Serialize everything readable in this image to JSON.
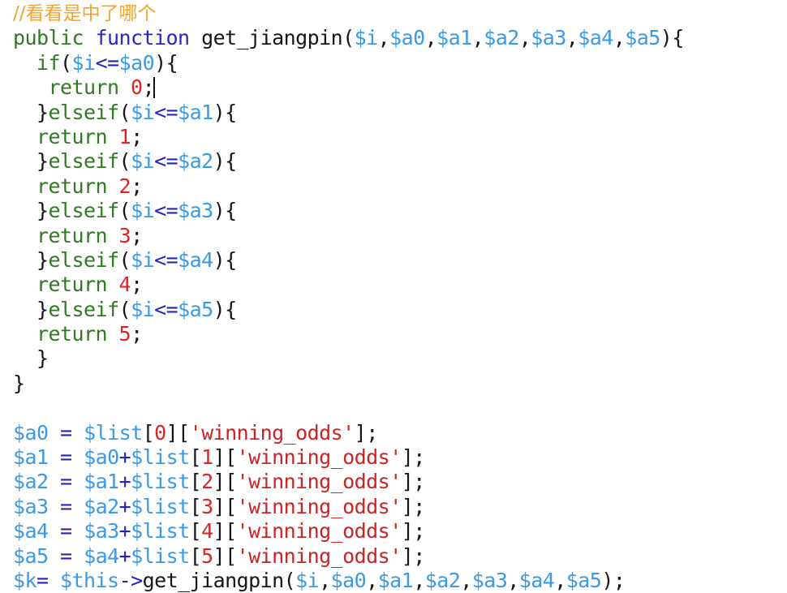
{
  "editor": {
    "language": "PHP",
    "background_color": "#ffffff",
    "caret_line_index": 3,
    "palette": {
      "comment": "#f5a42a",
      "keyword": "#2f7a22",
      "function_keyword": "#2626cc",
      "function_name": "#16161a",
      "variable": "#3a9ae8",
      "operator": "#2424bb",
      "number": "#e02222",
      "string": "#cc2424",
      "punctuation": "#16161a"
    }
  },
  "code_lines": [
    {
      "indent": "",
      "tokens": [
        {
          "t": "//看看是中了哪个",
          "c": "comment"
        }
      ]
    },
    {
      "indent": "",
      "tokens": [
        {
          "t": "public",
          "c": "keyword"
        },
        {
          "t": " ",
          "c": "plain"
        },
        {
          "t": "function",
          "c": "function"
        },
        {
          "t": " ",
          "c": "plain"
        },
        {
          "t": "get_jiangpin",
          "c": "fname"
        },
        {
          "t": "(",
          "c": "punct"
        },
        {
          "t": "$i",
          "c": "var"
        },
        {
          "t": ",",
          "c": "punct"
        },
        {
          "t": "$a0",
          "c": "var"
        },
        {
          "t": ",",
          "c": "punct"
        },
        {
          "t": "$a1",
          "c": "var"
        },
        {
          "t": ",",
          "c": "punct"
        },
        {
          "t": "$a2",
          "c": "var"
        },
        {
          "t": ",",
          "c": "punct"
        },
        {
          "t": "$a3",
          "c": "var"
        },
        {
          "t": ",",
          "c": "punct"
        },
        {
          "t": "$a4",
          "c": "var"
        },
        {
          "t": ",",
          "c": "punct"
        },
        {
          "t": "$a5",
          "c": "var"
        },
        {
          "t": ")",
          "c": "punct"
        },
        {
          "t": "{",
          "c": "punct"
        }
      ]
    },
    {
      "indent": "  ",
      "tokens": [
        {
          "t": "if",
          "c": "keyword"
        },
        {
          "t": "(",
          "c": "punct"
        },
        {
          "t": "$i",
          "c": "var"
        },
        {
          "t": "<=",
          "c": "op"
        },
        {
          "t": "$a0",
          "c": "var"
        },
        {
          "t": ")",
          "c": "punct"
        },
        {
          "t": "{",
          "c": "punct"
        }
      ]
    },
    {
      "indent": "   ",
      "tokens": [
        {
          "t": "return",
          "c": "keyword"
        },
        {
          "t": " ",
          "c": "plain"
        },
        {
          "t": "0",
          "c": "num"
        },
        {
          "t": ";",
          "c": "punct"
        }
      ]
    },
    {
      "indent": "  ",
      "tokens": [
        {
          "t": "}",
          "c": "punct"
        },
        {
          "t": "elseif",
          "c": "keyword"
        },
        {
          "t": "(",
          "c": "punct"
        },
        {
          "t": "$i",
          "c": "var"
        },
        {
          "t": "<=",
          "c": "op"
        },
        {
          "t": "$a1",
          "c": "var"
        },
        {
          "t": ")",
          "c": "punct"
        },
        {
          "t": "{",
          "c": "punct"
        }
      ]
    },
    {
      "indent": "  ",
      "tokens": [
        {
          "t": "return",
          "c": "keyword"
        },
        {
          "t": " ",
          "c": "plain"
        },
        {
          "t": "1",
          "c": "num"
        },
        {
          "t": ";",
          "c": "punct"
        }
      ]
    },
    {
      "indent": "  ",
      "tokens": [
        {
          "t": "}",
          "c": "punct"
        },
        {
          "t": "elseif",
          "c": "keyword"
        },
        {
          "t": "(",
          "c": "punct"
        },
        {
          "t": "$i",
          "c": "var"
        },
        {
          "t": "<=",
          "c": "op"
        },
        {
          "t": "$a2",
          "c": "var"
        },
        {
          "t": ")",
          "c": "punct"
        },
        {
          "t": "{",
          "c": "punct"
        }
      ]
    },
    {
      "indent": "  ",
      "tokens": [
        {
          "t": "return",
          "c": "keyword"
        },
        {
          "t": " ",
          "c": "plain"
        },
        {
          "t": "2",
          "c": "num"
        },
        {
          "t": ";",
          "c": "punct"
        }
      ]
    },
    {
      "indent": "  ",
      "tokens": [
        {
          "t": "}",
          "c": "punct"
        },
        {
          "t": "elseif",
          "c": "keyword"
        },
        {
          "t": "(",
          "c": "punct"
        },
        {
          "t": "$i",
          "c": "var"
        },
        {
          "t": "<=",
          "c": "op"
        },
        {
          "t": "$a3",
          "c": "var"
        },
        {
          "t": ")",
          "c": "punct"
        },
        {
          "t": "{",
          "c": "punct"
        }
      ]
    },
    {
      "indent": "  ",
      "tokens": [
        {
          "t": "return",
          "c": "keyword"
        },
        {
          "t": " ",
          "c": "plain"
        },
        {
          "t": "3",
          "c": "num"
        },
        {
          "t": ";",
          "c": "punct"
        }
      ]
    },
    {
      "indent": "  ",
      "tokens": [
        {
          "t": "}",
          "c": "punct"
        },
        {
          "t": "elseif",
          "c": "keyword"
        },
        {
          "t": "(",
          "c": "punct"
        },
        {
          "t": "$i",
          "c": "var"
        },
        {
          "t": "<=",
          "c": "op"
        },
        {
          "t": "$a4",
          "c": "var"
        },
        {
          "t": ")",
          "c": "punct"
        },
        {
          "t": "{",
          "c": "punct"
        }
      ]
    },
    {
      "indent": "  ",
      "tokens": [
        {
          "t": "return",
          "c": "keyword"
        },
        {
          "t": " ",
          "c": "plain"
        },
        {
          "t": "4",
          "c": "num"
        },
        {
          "t": ";",
          "c": "punct"
        }
      ]
    },
    {
      "indent": "  ",
      "tokens": [
        {
          "t": "}",
          "c": "punct"
        },
        {
          "t": "elseif",
          "c": "keyword"
        },
        {
          "t": "(",
          "c": "punct"
        },
        {
          "t": "$i",
          "c": "var"
        },
        {
          "t": "<=",
          "c": "op"
        },
        {
          "t": "$a5",
          "c": "var"
        },
        {
          "t": ")",
          "c": "punct"
        },
        {
          "t": "{",
          "c": "punct"
        }
      ]
    },
    {
      "indent": "  ",
      "tokens": [
        {
          "t": "return",
          "c": "keyword"
        },
        {
          "t": " ",
          "c": "plain"
        },
        {
          "t": "5",
          "c": "num"
        },
        {
          "t": ";",
          "c": "punct"
        }
      ]
    },
    {
      "indent": "  ",
      "tokens": [
        {
          "t": "}",
          "c": "punct"
        }
      ]
    },
    {
      "indent": "",
      "tokens": [
        {
          "t": "}",
          "c": "punct"
        }
      ]
    },
    {
      "indent": "",
      "tokens": []
    },
    {
      "indent": "",
      "tokens": [
        {
          "t": "$a0",
          "c": "var"
        },
        {
          "t": " ",
          "c": "plain"
        },
        {
          "t": "=",
          "c": "op"
        },
        {
          "t": " ",
          "c": "plain"
        },
        {
          "t": "$list",
          "c": "var"
        },
        {
          "t": "[",
          "c": "punct"
        },
        {
          "t": "0",
          "c": "num"
        },
        {
          "t": "]",
          "c": "punct"
        },
        {
          "t": "[",
          "c": "punct"
        },
        {
          "t": "'winning_odds'",
          "c": "string"
        },
        {
          "t": "]",
          "c": "punct"
        },
        {
          "t": ";",
          "c": "punct"
        }
      ]
    },
    {
      "indent": "",
      "tokens": [
        {
          "t": "$a1",
          "c": "var"
        },
        {
          "t": " ",
          "c": "plain"
        },
        {
          "t": "=",
          "c": "op"
        },
        {
          "t": " ",
          "c": "plain"
        },
        {
          "t": "$a0",
          "c": "var"
        },
        {
          "t": "+",
          "c": "op"
        },
        {
          "t": "$list",
          "c": "var"
        },
        {
          "t": "[",
          "c": "punct"
        },
        {
          "t": "1",
          "c": "num"
        },
        {
          "t": "]",
          "c": "punct"
        },
        {
          "t": "[",
          "c": "punct"
        },
        {
          "t": "'winning_odds'",
          "c": "string"
        },
        {
          "t": "]",
          "c": "punct"
        },
        {
          "t": ";",
          "c": "punct"
        }
      ]
    },
    {
      "indent": "",
      "tokens": [
        {
          "t": "$a2",
          "c": "var"
        },
        {
          "t": " ",
          "c": "plain"
        },
        {
          "t": "=",
          "c": "op"
        },
        {
          "t": " ",
          "c": "plain"
        },
        {
          "t": "$a1",
          "c": "var"
        },
        {
          "t": "+",
          "c": "op"
        },
        {
          "t": "$list",
          "c": "var"
        },
        {
          "t": "[",
          "c": "punct"
        },
        {
          "t": "2",
          "c": "num"
        },
        {
          "t": "]",
          "c": "punct"
        },
        {
          "t": "[",
          "c": "punct"
        },
        {
          "t": "'winning_odds'",
          "c": "string"
        },
        {
          "t": "]",
          "c": "punct"
        },
        {
          "t": ";",
          "c": "punct"
        }
      ]
    },
    {
      "indent": "",
      "tokens": [
        {
          "t": "$a3",
          "c": "var"
        },
        {
          "t": " ",
          "c": "plain"
        },
        {
          "t": "=",
          "c": "op"
        },
        {
          "t": " ",
          "c": "plain"
        },
        {
          "t": "$a2",
          "c": "var"
        },
        {
          "t": "+",
          "c": "op"
        },
        {
          "t": "$list",
          "c": "var"
        },
        {
          "t": "[",
          "c": "punct"
        },
        {
          "t": "3",
          "c": "num"
        },
        {
          "t": "]",
          "c": "punct"
        },
        {
          "t": "[",
          "c": "punct"
        },
        {
          "t": "'winning_odds'",
          "c": "string"
        },
        {
          "t": "]",
          "c": "punct"
        },
        {
          "t": ";",
          "c": "punct"
        }
      ]
    },
    {
      "indent": "",
      "tokens": [
        {
          "t": "$a4",
          "c": "var"
        },
        {
          "t": " ",
          "c": "plain"
        },
        {
          "t": "=",
          "c": "op"
        },
        {
          "t": " ",
          "c": "plain"
        },
        {
          "t": "$a3",
          "c": "var"
        },
        {
          "t": "+",
          "c": "op"
        },
        {
          "t": "$list",
          "c": "var"
        },
        {
          "t": "[",
          "c": "punct"
        },
        {
          "t": "4",
          "c": "num"
        },
        {
          "t": "]",
          "c": "punct"
        },
        {
          "t": "[",
          "c": "punct"
        },
        {
          "t": "'winning_odds'",
          "c": "string"
        },
        {
          "t": "]",
          "c": "punct"
        },
        {
          "t": ";",
          "c": "punct"
        }
      ]
    },
    {
      "indent": "",
      "tokens": [
        {
          "t": "$a5",
          "c": "var"
        },
        {
          "t": " ",
          "c": "plain"
        },
        {
          "t": "=",
          "c": "op"
        },
        {
          "t": " ",
          "c": "plain"
        },
        {
          "t": "$a4",
          "c": "var"
        },
        {
          "t": "+",
          "c": "op"
        },
        {
          "t": "$list",
          "c": "var"
        },
        {
          "t": "[",
          "c": "punct"
        },
        {
          "t": "5",
          "c": "num"
        },
        {
          "t": "]",
          "c": "punct"
        },
        {
          "t": "[",
          "c": "punct"
        },
        {
          "t": "'winning_odds'",
          "c": "string"
        },
        {
          "t": "]",
          "c": "punct"
        },
        {
          "t": ";",
          "c": "punct"
        }
      ]
    },
    {
      "indent": "",
      "tokens": [
        {
          "t": "$k",
          "c": "var"
        },
        {
          "t": "=",
          "c": "op"
        },
        {
          "t": " ",
          "c": "plain"
        },
        {
          "t": "$this",
          "c": "var"
        },
        {
          "t": "->",
          "c": "op"
        },
        {
          "t": "get_jiangpin",
          "c": "fname"
        },
        {
          "t": "(",
          "c": "punct"
        },
        {
          "t": "$i",
          "c": "var"
        },
        {
          "t": ",",
          "c": "punct"
        },
        {
          "t": "$a0",
          "c": "var"
        },
        {
          "t": ",",
          "c": "punct"
        },
        {
          "t": "$a1",
          "c": "var"
        },
        {
          "t": ",",
          "c": "punct"
        },
        {
          "t": "$a2",
          "c": "var"
        },
        {
          "t": ",",
          "c": "punct"
        },
        {
          "t": "$a3",
          "c": "var"
        },
        {
          "t": ",",
          "c": "punct"
        },
        {
          "t": "$a4",
          "c": "var"
        },
        {
          "t": ",",
          "c": "punct"
        },
        {
          "t": "$a5",
          "c": "var"
        },
        {
          "t": ")",
          "c": "punct"
        },
        {
          "t": ";",
          "c": "punct"
        }
      ]
    }
  ]
}
